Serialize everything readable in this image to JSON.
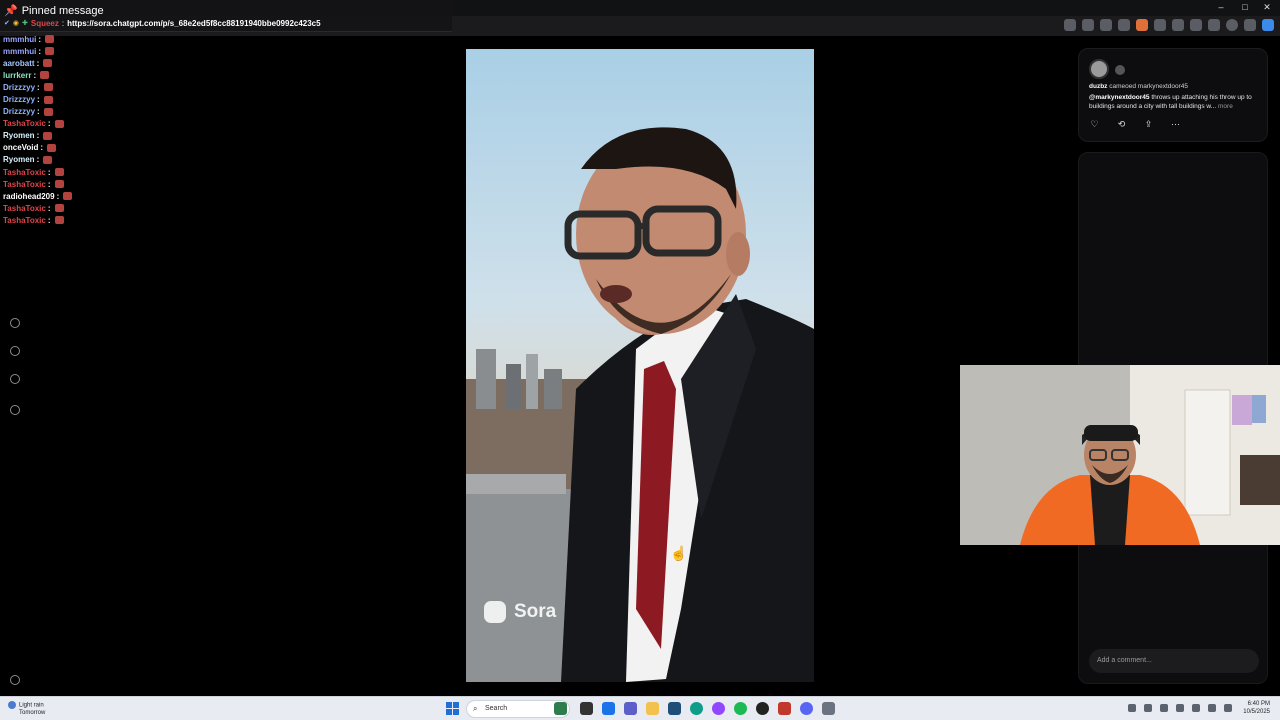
{
  "pinned": {
    "title": "Pinned message",
    "user": "Squeez",
    "url": "https://sora.chatgpt.com/p/s_68e2ed5f8cc88191940bbe0992c423c5"
  },
  "chat": [
    {
      "user": "mmmhui",
      "color": "#9aa6ff"
    },
    {
      "user": "mmmhui",
      "color": "#9aa6ff"
    },
    {
      "user": "aarobatt",
      "color": "#a7c8ff"
    },
    {
      "user": "lurrkerr",
      "color": "#8de0c5"
    },
    {
      "user": "Drizzzyy",
      "color": "#8fb3ff"
    },
    {
      "user": "Drizzzyy",
      "color": "#8fb3ff"
    },
    {
      "user": "Drizzzyy",
      "color": "#8fb3ff"
    },
    {
      "user": "TashaToxic",
      "color": "#e0444a"
    },
    {
      "user": "Ryomen",
      "color": "#d9f2ff"
    },
    {
      "user": "onceVoid",
      "color": "#ffffff"
    },
    {
      "user": "Ryomen",
      "color": "#d9f2ff"
    },
    {
      "user": "TashaToxic",
      "color": "#e0444a"
    },
    {
      "user": "TashaToxic",
      "color": "#e0444a"
    },
    {
      "user": "radiohead209",
      "color": "#ffffff"
    },
    {
      "user": "TashaToxic",
      "color": "#e0444a"
    },
    {
      "user": "TashaToxic",
      "color": "#e0444a"
    }
  ],
  "video": {
    "watermark": "Sora"
  },
  "post": {
    "author": "duzbz",
    "cameo_text": "cameoed markynextdoor45",
    "mention": "@markynextdoor45",
    "body": "throws up attaching his throw up to buildings around a city with tall buildings w...",
    "more": "more",
    "actions": [
      "heart-icon",
      "remix-icon",
      "share-icon",
      "more-icon"
    ]
  },
  "comments": {
    "placeholder": "Add a comment..."
  },
  "taskbar": {
    "weather_line1": "Light rain",
    "weather_line2": "Tomorrow",
    "search_label": "Search",
    "time": "6:40 PM",
    "date": "10/5/2025"
  },
  "colors": {
    "accent_red": "#e0444a",
    "panel_bg": "#0d0d0f",
    "taskbar_bg": "#e8ecf2"
  }
}
